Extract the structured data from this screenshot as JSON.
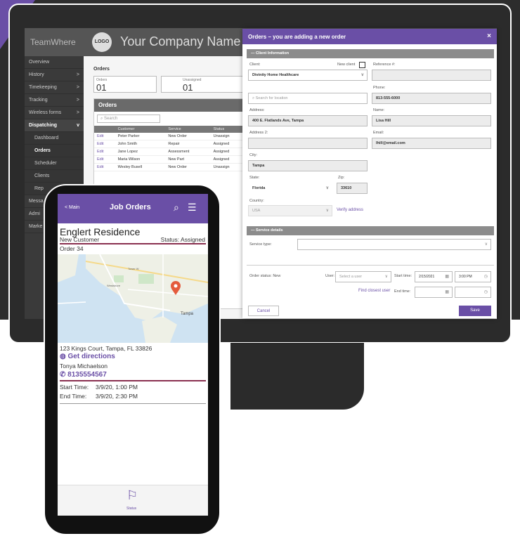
{
  "sidebar": {
    "brand": "TeamWhere",
    "items": [
      {
        "label": "Overview"
      },
      {
        "label": "History",
        "arrow": ">"
      },
      {
        "label": "Timekeeping",
        "arrow": ">"
      },
      {
        "label": "Tracking",
        "arrow": ">"
      },
      {
        "label": "Wireless forms",
        "arrow": ">"
      },
      {
        "label": "Dispatching",
        "arrow": "v"
      },
      {
        "label": "Dashboard"
      },
      {
        "label": "Orders"
      },
      {
        "label": "Scheduler"
      },
      {
        "label": "Clients"
      },
      {
        "label": "Rep"
      },
      {
        "label": "Messa"
      },
      {
        "label": "Admi"
      },
      {
        "label": "Marke"
      }
    ]
  },
  "header": {
    "logo": "LOGO",
    "company": "Your Company Name"
  },
  "orders_page": {
    "label": "Orders",
    "orders_label": "Orders",
    "orders_count": "01",
    "unassigned_label": "Unassigned",
    "unassigned_count": "01",
    "panel_title": "Orders",
    "search_placeholder": "Search",
    "columns": [
      "",
      "Customer",
      "Service",
      "Status"
    ],
    "rows": [
      [
        "Edit",
        "Peter Parker",
        "New Order",
        "Unassign"
      ],
      [
        "Edit",
        "John Smith",
        "Repair",
        "Assigned"
      ],
      [
        "Edit",
        "Jane Lopez",
        "Assessment",
        "Assigned"
      ],
      [
        "Edit",
        "Maria Wilson",
        "New Part",
        "Assigned"
      ],
      [
        "Edit",
        "Wesley Busell",
        "New Order",
        "Unassign"
      ]
    ]
  },
  "modal": {
    "title": "Orders – you are adding a new order",
    "close": "×",
    "client_section": "Client Information",
    "client_label": "Client:",
    "new_client_label": "New client",
    "client_value": "Divinity Home Healthcare",
    "reference_label": "Reference #:",
    "location_placeholder": "Search for location",
    "phone_label": "Phone:",
    "phone_value": "813-555-6000",
    "address_label": "Address:",
    "address_value": "400 E. Flatlands Ave, Tampa",
    "name_label": "Name:",
    "name_value": "Lisa Hill",
    "address2_label": "Address 2:",
    "email_label": "Email:",
    "email_value": "lhill@email.com",
    "city_label": "City:",
    "city_value": "Tampa",
    "state_label": "State:",
    "state_value": "Florida",
    "zip_label": "Zip:",
    "zip_value": "33610",
    "country_label": "Country:",
    "country_value": "USA",
    "verify_link": "Verify address",
    "service_section": "Service details",
    "service_type_label": "Service type:",
    "order_status_label": "Order status:",
    "order_status_value": "New",
    "user_label": "User:",
    "user_placeholder": "Select a user",
    "start_label": "Start time:",
    "start_date": "2/15/2021",
    "start_time": "3:00 PM",
    "find_user_link": "Find closest user",
    "end_label": "End time:",
    "cancel": "Cancel",
    "save": "Save"
  },
  "phone": {
    "back": "< Main",
    "title": "Job Orders",
    "residence": "Englert Residence",
    "customer_type": "New Customer",
    "status": "Status: Assigned",
    "order": "Order 34",
    "address": "123 Kings Court, Tampa, FL 33826",
    "directions": "Get directions",
    "contact": "Tonya Michaelson",
    "phone": "8135554567",
    "start_label": "Start Time:",
    "start_value": "3/9/20, 1:00 PM",
    "end_label": "End Time:",
    "end_value": "3/9/20, 2:30 PM",
    "footer_label": "Status",
    "map_labels": {
      "city": "Tampa",
      "area1": "Tower W",
      "area2": "Westshore"
    }
  },
  "colors": {
    "accent": "#6a4fa6",
    "sidebar": "#3a3a3a",
    "divider": "#8a3050"
  }
}
